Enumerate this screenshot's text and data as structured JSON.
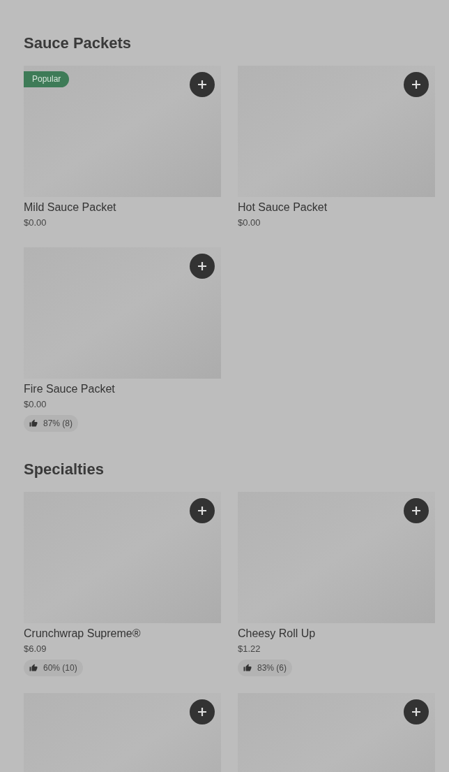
{
  "sections": [
    {
      "title": "Sauce Packets",
      "items": [
        {
          "kind": "full",
          "name": "Mild Sauce Packet",
          "price": "$0.00",
          "badge": "Popular"
        },
        {
          "kind": "full",
          "name": "Hot Sauce Packet",
          "price": "$0.00"
        },
        {
          "kind": "full",
          "name": "Fire Sauce Packet",
          "price": "$0.00",
          "rating": "87% (8)"
        }
      ]
    },
    {
      "title": "Specialties",
      "items": [
        {
          "kind": "full",
          "name": "Crunchwrap Supreme®",
          "price": "$6.09",
          "rating": "60% (10)"
        },
        {
          "kind": "full",
          "name": "Cheesy Roll Up",
          "price": "$1.22",
          "rating": "83% (6)"
        },
        {
          "kind": "image_only"
        },
        {
          "kind": "image_only"
        }
      ]
    }
  ]
}
